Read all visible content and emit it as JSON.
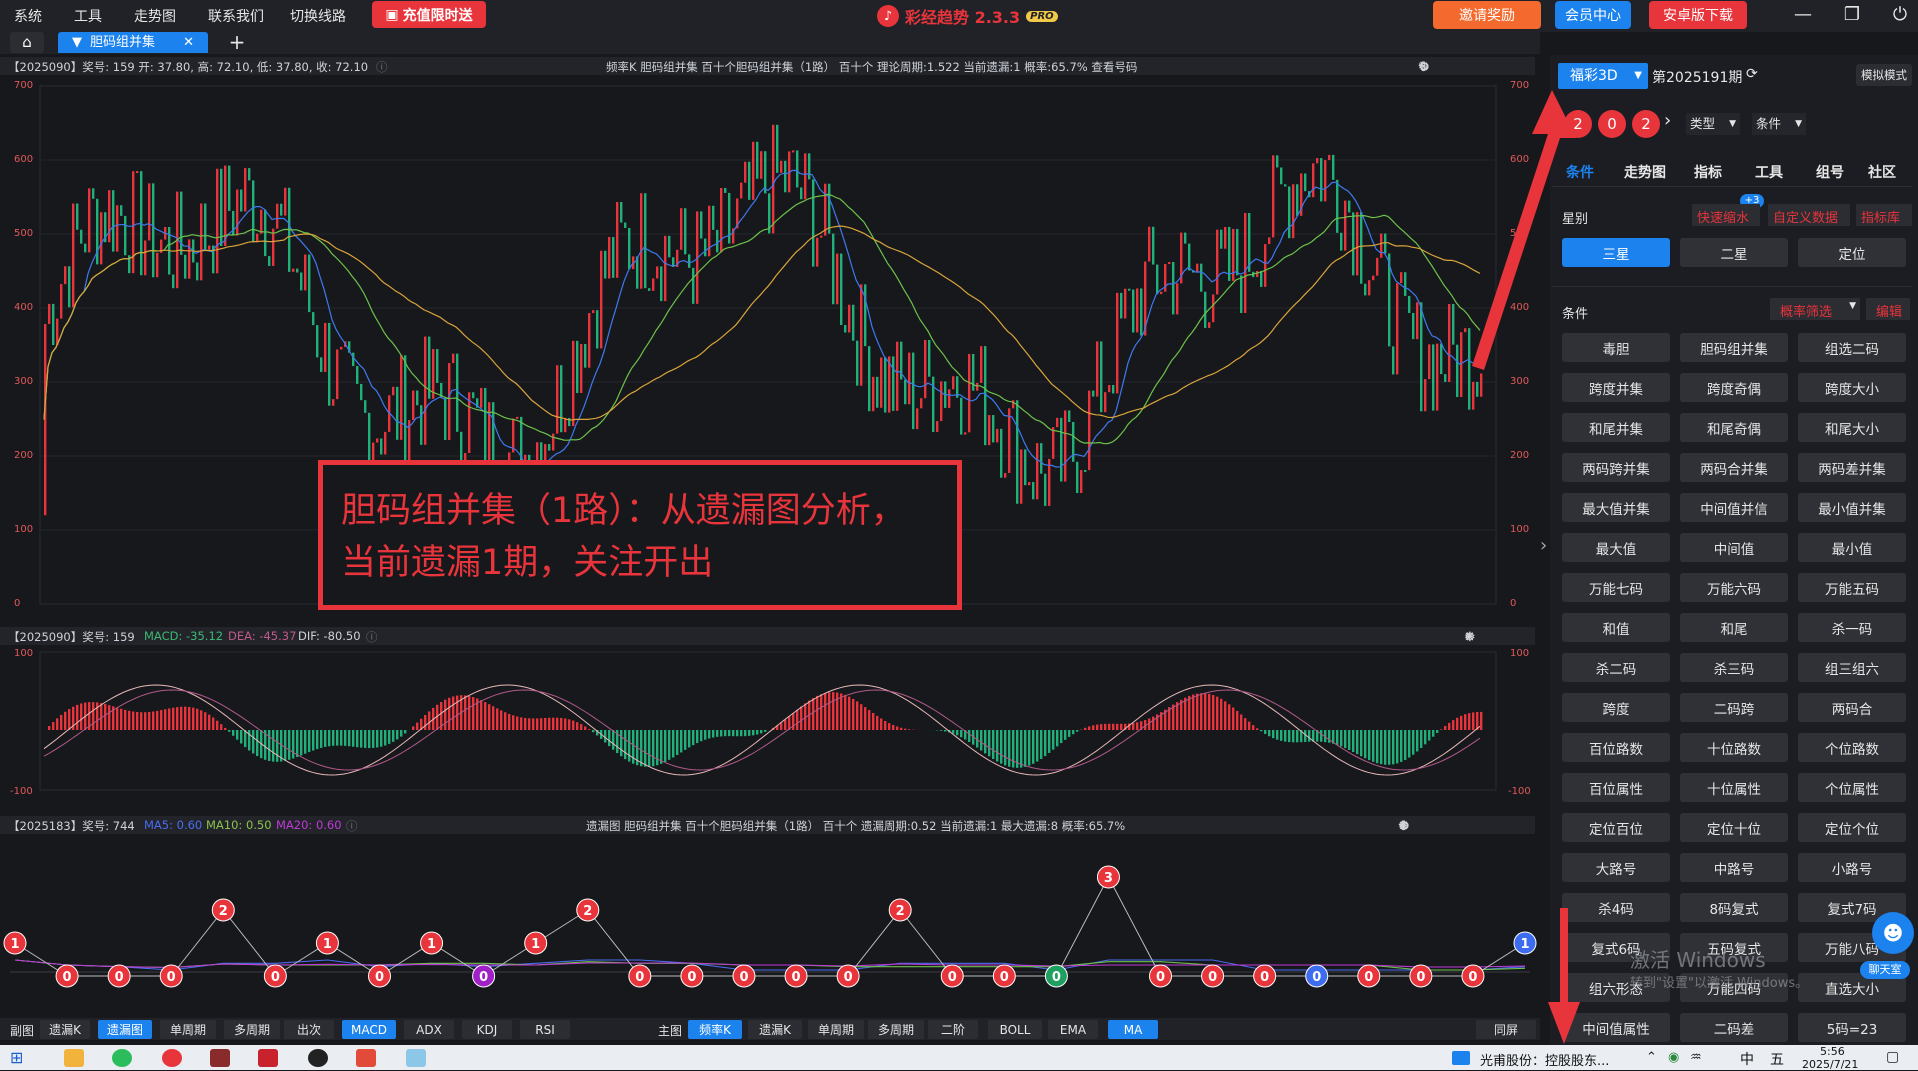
{
  "menu": [
    "系统",
    "工具",
    "走势图",
    "联系我们",
    "切换线路"
  ],
  "recharge": "充值限时送",
  "app_title": "彩经趋势 2.3.3",
  "app_badge": "PRO",
  "top_buttons": {
    "invite": "邀请奖励",
    "member": "会员中心",
    "android": "安卓版下载"
  },
  "window_controls": [
    "—",
    "❐",
    "⏻"
  ],
  "tabs": {
    "home": "⌂",
    "active": "胆码组并集",
    "close": "✕",
    "add": "+"
  },
  "main_chart": {
    "info": "【2025090】奖号: 159  开: 37.80, 高: 72.10, 低: 37.80, 收: 72.10",
    "center": "频率K  胆码组并集  百十个胆码组并集（1路）  百十个  理论周期:1.522  当前遗漏:1  概率:65.7%  查看号码",
    "y_ticks": [
      "700",
      "600",
      "500",
      "400",
      "300",
      "200",
      "100",
      "0"
    ]
  },
  "macd_chart": {
    "info_prefix": "【2025090】奖号: 159",
    "macd": "MACD: -35.12",
    "dea": "DEA: -45.37",
    "dif": "DIF: -80.50",
    "y_ticks": [
      "100",
      "-100"
    ]
  },
  "omission_chart": {
    "info_prefix": "【2025183】奖号: 744",
    "ma5": "MA5: 0.60",
    "ma10": "MA10: 0.50",
    "ma20": "MA20: 0.60",
    "center": "遗漏图  胆码组并集  百十个胆码组并集（1路）  百十个  遗漏周期:0.52  当前遗漏:1  最大遗漏:8  概率:65.7%"
  },
  "chart_data": {
    "type": "line",
    "title": "遗漏图",
    "x": [
      1,
      2,
      3,
      4,
      5,
      6,
      7,
      8,
      9,
      10,
      11,
      12,
      13,
      14,
      15,
      16,
      17,
      18,
      19,
      20,
      21,
      22,
      23,
      24,
      25,
      26,
      27,
      28,
      29,
      30
    ],
    "values": [
      1,
      0,
      0,
      0,
      2,
      0,
      1,
      0,
      1,
      0,
      1,
      2,
      0,
      0,
      0,
      0,
      0,
      2,
      0,
      0,
      0,
      3,
      0,
      0,
      0,
      0,
      0,
      0,
      0,
      1
    ],
    "ylim": [
      0,
      3
    ]
  },
  "annotation": [
    "胆码组并集（1路）：从遗漏图分析，",
    "当前遗漏1期，关注开出"
  ],
  "bottom_bar": {
    "sub_label": "副图",
    "sub": [
      "遗漏K",
      "遗漏图",
      "单周期",
      "多周期",
      "出次",
      "MACD",
      "ADX",
      "KDJ",
      "RSI"
    ],
    "main_label": "主图",
    "main": [
      "频率K",
      "遗漏K",
      "单周期",
      "多周期",
      "二阶",
      "BOLL",
      "EMA",
      "MA"
    ],
    "fullscreen": "同屏"
  },
  "right_panel": {
    "lottery": "福彩3D",
    "period": "第2025191期",
    "mode": "模拟模式",
    "balls": [
      "2",
      "0",
      "2"
    ],
    "type_dd": "类型",
    "cond_dd": "条件",
    "tabs": [
      "条件",
      "走势图",
      "指标",
      "工具",
      "组号",
      "社区"
    ],
    "star_label": "星别",
    "badge": "+3",
    "quick": "快速缩水",
    "custom": "自定义数据",
    "lib": "指标库",
    "stars": [
      "三星",
      "二星",
      "定位"
    ],
    "cond_label": "条件",
    "filter": "概率筛选",
    "edit": "编辑",
    "conditions": [
      "毒胆",
      "胆码组并集",
      "组选二码",
      "跨度并集",
      "跨度奇偶",
      "跨度大小",
      "和尾并集",
      "和尾奇偶",
      "和尾大小",
      "两码跨并集",
      "两码合并集",
      "两码差并集",
      "最大值并集",
      "中间值并信",
      "最小值并集",
      "最大值",
      "中间值",
      "最小值",
      "万能七码",
      "万能六码",
      "万能五码",
      "和值",
      "和尾",
      "杀一码",
      "杀二码",
      "杀三码",
      "组三组六",
      "跨度",
      "二码跨",
      "两码合",
      "百位路数",
      "十位路数",
      "个位路数",
      "百位属性",
      "十位属性",
      "个位属性",
      "定位百位",
      "定位十位",
      "定位个位",
      "大路号",
      "中路号",
      "小路号",
      "杀4码",
      "8码复式",
      "复式7码",
      "复式6码",
      "五码复式",
      "万能八码",
      "组六形态",
      "万能四码",
      "直选大小",
      "中间值属性",
      "二码差",
      "5码=23"
    ],
    "chat": "聊天室"
  },
  "watermark": {
    "line1": "激活 Windows",
    "line2": "转到\"设置\"以激活 Windows。"
  },
  "taskbar": {
    "news": "光甫股份：控股股东...",
    "ime": "中",
    "ime2": "五",
    "time": "5:56",
    "date": "2025/7/21"
  }
}
